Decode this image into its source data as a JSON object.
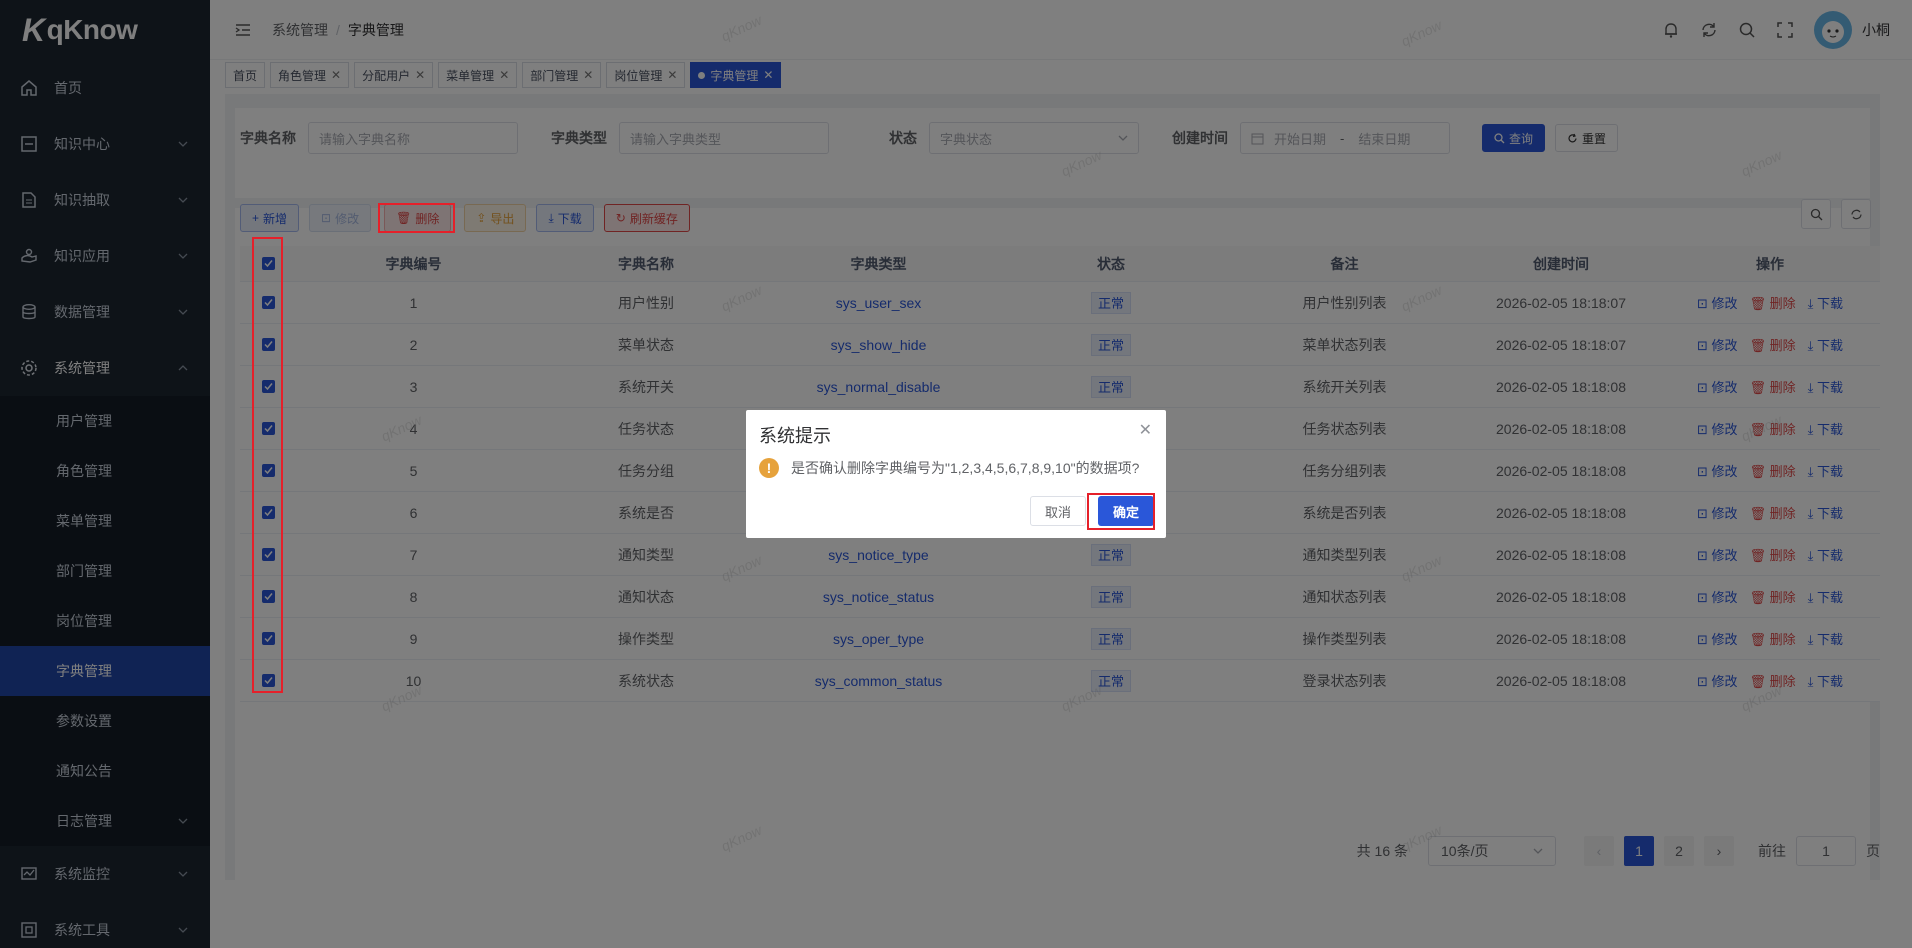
{
  "app": {
    "logo_text": "qKnow"
  },
  "sidebar": {
    "items": [
      {
        "label": "首页",
        "icon": "home-icon"
      },
      {
        "label": "知识中心",
        "icon": "book-icon"
      },
      {
        "label": "知识抽取",
        "icon": "document-icon"
      },
      {
        "label": "知识应用",
        "icon": "hand-icon"
      },
      {
        "label": "数据管理",
        "icon": "database-icon"
      },
      {
        "label": "系统管理",
        "icon": "gear-icon"
      },
      {
        "label": "系统监控",
        "icon": "monitor-icon"
      },
      {
        "label": "系统工具",
        "icon": "tool-icon"
      }
    ],
    "subitems": [
      "用户管理",
      "角色管理",
      "菜单管理",
      "部门管理",
      "岗位管理",
      "字典管理",
      "参数设置",
      "通知公告",
      "日志管理"
    ]
  },
  "navbar": {
    "breadcrumb": [
      "系统管理",
      "/",
      "字典管理"
    ],
    "username": "小桐"
  },
  "tags": [
    "首页",
    "角色管理",
    "分配用户",
    "菜单管理",
    "部门管理",
    "岗位管理",
    "字典管理"
  ],
  "search": {
    "dict_name_label": "字典名称",
    "dict_name_placeholder": "请输入字典名称",
    "dict_type_label": "字典类型",
    "dict_type_placeholder": "请输入字典类型",
    "status_label": "状态",
    "status_placeholder": "字典状态",
    "created_label": "创建时间",
    "start_placeholder": "开始日期",
    "date_sep": "-",
    "end_placeholder": "结束日期",
    "query_label": "查询",
    "reset_label": "重置"
  },
  "toolbar": {
    "add": "新增",
    "edit": "修改",
    "delete": "删除",
    "export": "导出",
    "download": "下载",
    "refresh_cache": "刷新缓存"
  },
  "table": {
    "headers": [
      "字典编号",
      "字典名称",
      "字典类型",
      "状态",
      "备注",
      "创建时间",
      "操作"
    ],
    "rows": [
      {
        "id": "1",
        "name": "用户性别",
        "type": "sys_user_sex",
        "status": "正常",
        "remark": "用户性别列表",
        "created": "2026-02-05 18:18:07"
      },
      {
        "id": "2",
        "name": "菜单状态",
        "type": "sys_show_hide",
        "status": "正常",
        "remark": "菜单状态列表",
        "created": "2026-02-05 18:18:07"
      },
      {
        "id": "3",
        "name": "系统开关",
        "type": "sys_normal_disable",
        "status": "正常",
        "remark": "系统开关列表",
        "created": "2026-02-05 18:18:08"
      },
      {
        "id": "4",
        "name": "任务状态",
        "type": "",
        "status": "",
        "remark": "任务状态列表",
        "created": "2026-02-05 18:18:08"
      },
      {
        "id": "5",
        "name": "任务分组",
        "type": "",
        "status": "",
        "remark": "任务分组列表",
        "created": "2026-02-05 18:18:08"
      },
      {
        "id": "6",
        "name": "系统是否",
        "type": "",
        "status": "",
        "remark": "系统是否列表",
        "created": "2026-02-05 18:18:08"
      },
      {
        "id": "7",
        "name": "通知类型",
        "type": "sys_notice_type",
        "status": "正常",
        "remark": "通知类型列表",
        "created": "2026-02-05 18:18:08"
      },
      {
        "id": "8",
        "name": "通知状态",
        "type": "sys_notice_status",
        "status": "正常",
        "remark": "通知状态列表",
        "created": "2026-02-05 18:18:08"
      },
      {
        "id": "9",
        "name": "操作类型",
        "type": "sys_oper_type",
        "status": "正常",
        "remark": "操作类型列表",
        "created": "2026-02-05 18:18:08"
      },
      {
        "id": "10",
        "name": "系统状态",
        "type": "sys_common_status",
        "status": "正常",
        "remark": "登录状态列表",
        "created": "2026-02-05 18:18:08"
      }
    ],
    "op_edit": "修改",
    "op_delete": "删除",
    "op_download": "下载"
  },
  "pagination": {
    "total_text": "共 16 条",
    "page_size": "10条/页",
    "pages": [
      "1",
      "2"
    ],
    "goto_label": "前往",
    "goto_value": "1",
    "page_suffix": "页"
  },
  "watermark": "qKnow",
  "dialog": {
    "title": "系统提示",
    "warn_glyph": "!",
    "message": "是否确认删除字典编号为\"1,2,3,4,5,6,7,8,9,10\"的数据项?",
    "cancel": "取消",
    "confirm": "确定"
  },
  "colors": {
    "primary": "#2a57d9",
    "sidebar": "#1c2631",
    "danger": "#e04848",
    "warning": "#e6a23c"
  }
}
